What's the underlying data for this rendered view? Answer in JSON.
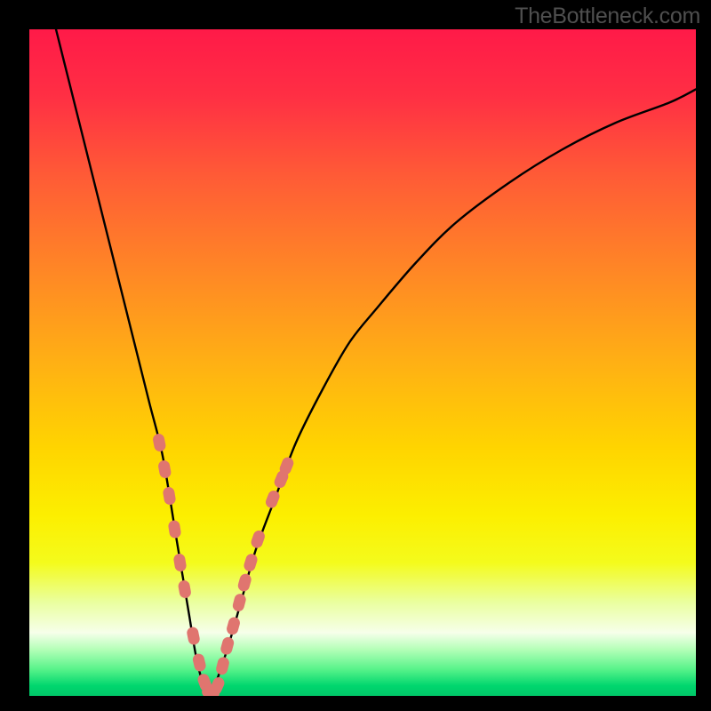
{
  "attribution": "TheBottleneck.com",
  "colors": {
    "gradient_stops": [
      {
        "offset": 0,
        "color": "#ff1a48"
      },
      {
        "offset": 0.1,
        "color": "#ff2f44"
      },
      {
        "offset": 0.22,
        "color": "#ff5b36"
      },
      {
        "offset": 0.35,
        "color": "#ff8327"
      },
      {
        "offset": 0.5,
        "color": "#ffb014"
      },
      {
        "offset": 0.63,
        "color": "#ffd500"
      },
      {
        "offset": 0.73,
        "color": "#fcef00"
      },
      {
        "offset": 0.8,
        "color": "#f4fb1c"
      },
      {
        "offset": 0.86,
        "color": "#eaffa0"
      },
      {
        "offset": 0.905,
        "color": "#f6ffea"
      },
      {
        "offset": 0.93,
        "color": "#b5ffb8"
      },
      {
        "offset": 0.96,
        "color": "#58f38a"
      },
      {
        "offset": 0.985,
        "color": "#00d66e"
      },
      {
        "offset": 1.0,
        "color": "#00c768"
      }
    ],
    "curve": "#000000",
    "marker": "#e0756f"
  },
  "chart_data": {
    "type": "line",
    "title": "",
    "xlabel": "",
    "ylabel": "",
    "xlim": [
      0,
      100
    ],
    "ylim": [
      0,
      100
    ],
    "series": [
      {
        "name": "bottleneck-curve",
        "x": [
          4,
          6,
          8,
          10,
          12,
          14,
          16,
          18,
          20,
          22,
          23,
          24,
          25,
          26,
          27,
          28,
          30,
          32,
          34,
          37,
          40,
          44,
          48,
          52,
          58,
          64,
          72,
          80,
          88,
          96,
          100
        ],
        "y": [
          100,
          92,
          84,
          76,
          68,
          60,
          52,
          44,
          36,
          24,
          18,
          12,
          6,
          2,
          0,
          2,
          8,
          15,
          22,
          30,
          38,
          46,
          53,
          58,
          65,
          71,
          77,
          82,
          86,
          89,
          91
        ]
      }
    ],
    "markers": {
      "name": "highlighted-hardware-points",
      "points": [
        {
          "x": 19.5,
          "y": 38.0
        },
        {
          "x": 20.3,
          "y": 34.0
        },
        {
          "x": 21.0,
          "y": 30.0
        },
        {
          "x": 21.8,
          "y": 25.0
        },
        {
          "x": 22.6,
          "y": 20.0
        },
        {
          "x": 23.3,
          "y": 16.0
        },
        {
          "x": 24.6,
          "y": 9.0
        },
        {
          "x": 25.5,
          "y": 5.0
        },
        {
          "x": 26.3,
          "y": 2.0
        },
        {
          "x": 27.2,
          "y": 0.5
        },
        {
          "x": 28.2,
          "y": 1.5
        },
        {
          "x": 29.0,
          "y": 4.5
        },
        {
          "x": 29.7,
          "y": 7.5
        },
        {
          "x": 30.6,
          "y": 10.5
        },
        {
          "x": 31.5,
          "y": 14.0
        },
        {
          "x": 32.3,
          "y": 17.0
        },
        {
          "x": 33.2,
          "y": 20.0
        },
        {
          "x": 34.3,
          "y": 23.5
        },
        {
          "x": 36.5,
          "y": 29.5
        },
        {
          "x": 37.8,
          "y": 32.5
        },
        {
          "x": 38.6,
          "y": 34.5
        }
      ]
    }
  }
}
